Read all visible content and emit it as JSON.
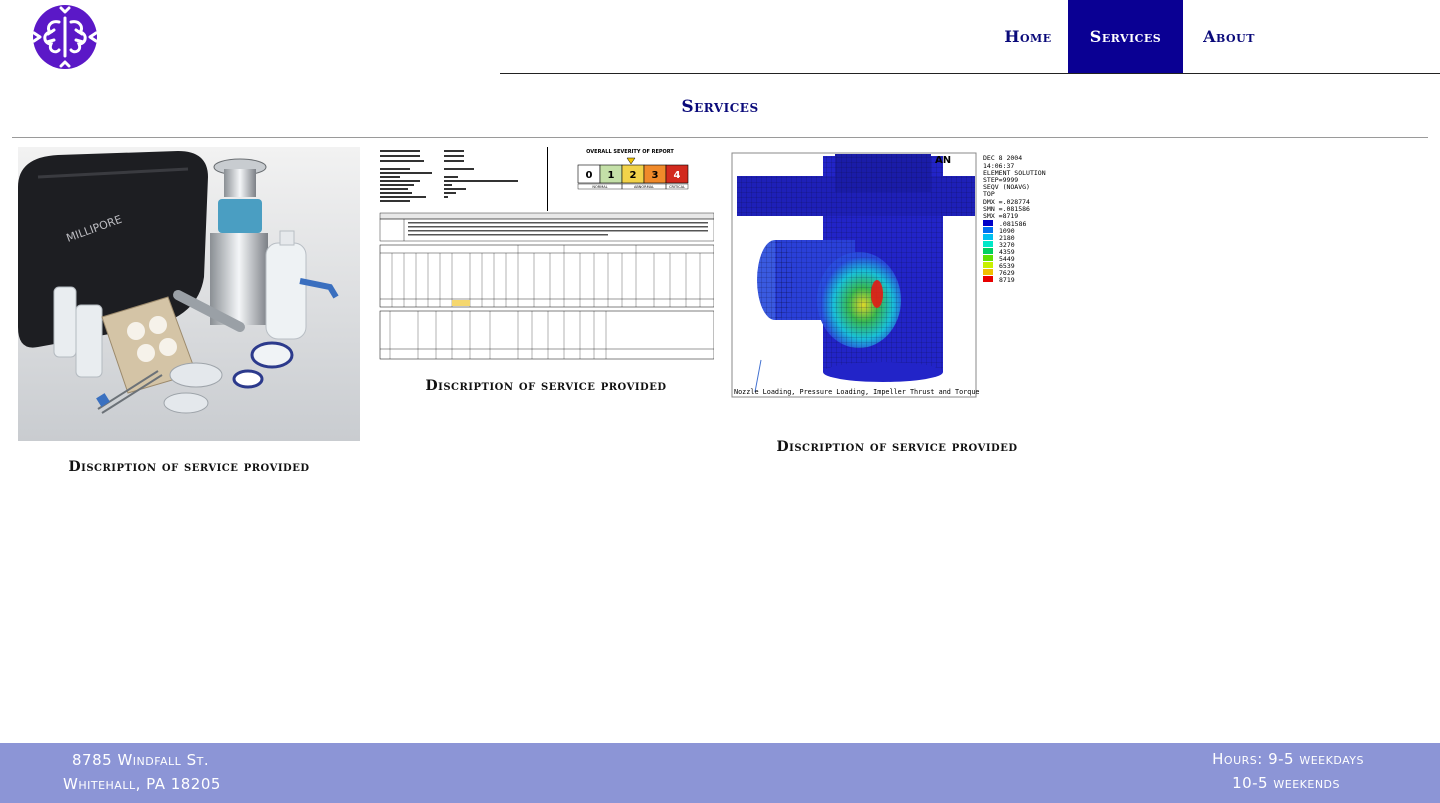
{
  "nav": {
    "items": [
      {
        "label": "Home"
      },
      {
        "label": "Services"
      },
      {
        "label": "About"
      }
    ],
    "active": "Services"
  },
  "page": {
    "title": "Services"
  },
  "services": [
    {
      "caption": "Discription of service provided"
    },
    {
      "caption": "Discription of service provided"
    },
    {
      "caption": "Discription of service provided"
    }
  ],
  "report_image": {
    "severity_title": "OVERALL SEVERITY OF REPORT",
    "severity_levels": [
      "0",
      "1",
      "2",
      "3",
      "4"
    ],
    "severity_labels": [
      "NORMAL",
      "ABNORMAL",
      "CRITICAL"
    ]
  },
  "fea_image": {
    "date": "DEC  8 2004",
    "time": "14:06:37",
    "lines": [
      "ELEMENT SOLUTION",
      "STEP=9999",
      "SEQV      (NOAVG)",
      "TOP",
      "DMX =.028774",
      "SMN =.081586",
      "SMX =8719"
    ],
    "legend_values": [
      ".081586",
      "1090",
      "2180",
      "3270",
      "4359",
      "5449",
      "6539",
      "7629",
      "8719"
    ],
    "caption_text": "Nozzle Loading, Pressure Loading, Impeller Thrust and Torque",
    "brand": "AN"
  },
  "product_image": {
    "brand": "MILLIPORE"
  },
  "footer": {
    "address_line1": "8785 Windfall St.",
    "address_line2": "Whitehall, PA 18205",
    "hours_line1": "Hours: 9-5 weekdays",
    "hours_line2": "10-5 weekends"
  },
  "colors": {
    "nav_text": "#0a0a7a",
    "nav_active_bg": "#0a0093",
    "footer_bg": "#8c95d6",
    "logo": "#5b18c7"
  }
}
